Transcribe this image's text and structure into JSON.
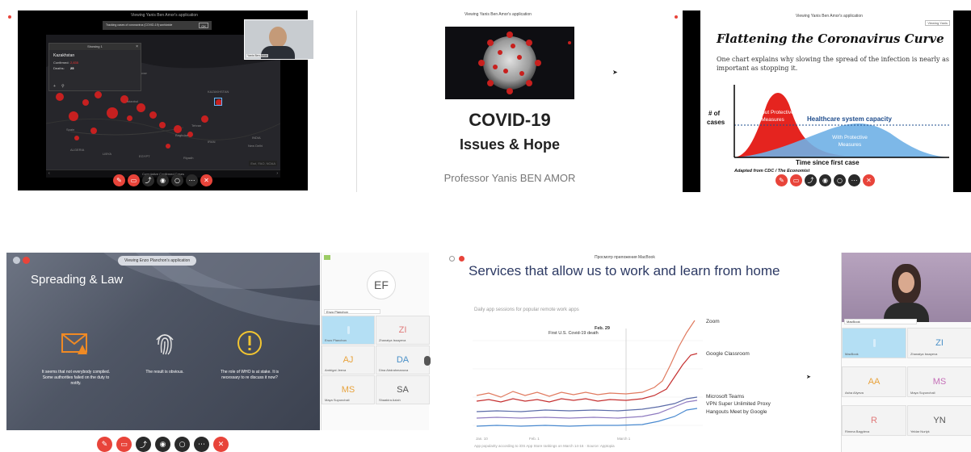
{
  "panel1": {
    "viewing": "Viewing Yanis Ben Amor's application",
    "notice": "Tracking cases of coronavirus (COVID-19) worldwide",
    "notice_btn": "OK",
    "popup_title": "Showing 1",
    "popup_country": "Kazakhstan",
    "popup_confirmed_label": "Confirmed:",
    "popup_confirmed_value": "2,835",
    "popup_deaths_label": "Deaths:",
    "popup_deaths_value": "25",
    "map_labels": [
      "Moscow",
      "Spain",
      "ALGERIA",
      "LIBYA",
      "EGYPT",
      "Baghdad",
      "Riyadh",
      "Tehran",
      "IRAN",
      "KAZAKHSTAN",
      "New Delhi",
      "INDIA",
      "Istanbul"
    ],
    "footer": "Cumulative Confirmed Cases",
    "credit": "Esri, FAO, NOAA",
    "cam_label": "Yanis Ben Amor"
  },
  "panel2": {
    "viewing": "Viewing Yanis Ben Amor's application",
    "title": "COVID-19",
    "subtitle": "Issues & Hope",
    "presenter": "Professor Yanis BEN AMOR"
  },
  "panel3": {
    "viewing": "Viewing Yanis Ben Amor's application",
    "tab_label": "Viewing Yanis",
    "title": "Flattening the Coronavirus Curve",
    "subtitle": "One chart explains why slowing the spread of the infection is nearly as important as stopping it.",
    "y_label_1": "# of",
    "y_label_2": "cases",
    "red_label": "Without Protective Measures",
    "capacity_label": "Healthcare system capacity",
    "blue_label": "With Protective Measures",
    "x_label": "Time since first case",
    "source": "Adapted from CDC / The Economist"
  },
  "panel4": {
    "viewing": "Viewing Enzo Planchon's application",
    "title": "Spreading & Law",
    "items": [
      {
        "icon": "warning-envelope-icon",
        "text": "It seems that not everybody complied. Some authorities failed on the duty to notify."
      },
      {
        "icon": "fingerprint-icon",
        "text": "The result is obvious."
      },
      {
        "icon": "exclamation-icon",
        "text": "The role of WHO is at stake. It is necessary to re discuss it now?"
      }
    ],
    "big_initials": "EF",
    "big_name": "Enzo Planchon",
    "tiles": [
      {
        "initials": "",
        "name": "Enzo Planchon"
      },
      {
        "initials": "ZI",
        "name": "Zhanaiya Issayeva"
      },
      {
        "initials": "AJ",
        "name": "Ambigai Jeeva"
      },
      {
        "initials": "DA",
        "name": "Dina Abdrahmanova"
      },
      {
        "initials": "MS",
        "name": "Maya Suyunchali"
      },
      {
        "initials": "SA",
        "name": "Shaakira Aziah"
      }
    ],
    "colors": {
      "accent_orange": "#f08a24",
      "accent_yellow": "#f2c531"
    }
  },
  "panel5": {
    "viewing": "Просмотр приложения MacBook",
    "title": "Services that allow us to work and learn from home",
    "chart_title": "Daily app sessions for popular remote work apps",
    "annotation_date": "Feb. 29",
    "annotation_text": "First U.S. Covid-19 death",
    "x_ticks": [
      "Jan. 10",
      "Feb. 1",
      "March 1"
    ],
    "series_labels": [
      "Zoom",
      "Google Classroom",
      "Microsoft Teams",
      "VPN Super Unlimited Proxy",
      "Hangouts Meet by Google"
    ],
    "footnote": "App popularity according to iOS App Store rankings on March 14-16 · Source: Apptopia",
    "self_name": "MacBook",
    "tiles": [
      {
        "initials": "",
        "name": "MacBook"
      },
      {
        "initials": "ZI",
        "name": "Zhanaiya Issayeva"
      },
      {
        "initials": "AA",
        "name": "Asha Aliyeva"
      },
      {
        "initials": "MS",
        "name": "Maya Suyunchali"
      },
      {
        "initials": "R",
        "name": "Rimma Bagyleva"
      },
      {
        "initials": "YN",
        "name": "Yeldar Nurlyk"
      }
    ]
  }
}
